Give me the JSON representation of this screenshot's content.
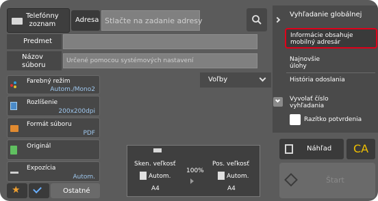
{
  "header": {
    "phonebook_label": "Telefónny\nzoznam",
    "address_tab": "Adresa",
    "address_placeholder": "Stlačte na zadanie adresy"
  },
  "fields": {
    "subject_label": "Predmet",
    "filename_label": "Názov\nsúboru",
    "filename_value": "Určené pomocou systémových nastavení"
  },
  "settings": {
    "color_mode": {
      "label": "Farebný režim",
      "value": "Autom./Mono2"
    },
    "resolution": {
      "label": "Rozlíšenie",
      "value": "200x200dpi"
    },
    "file_format": {
      "label": "Formát súboru",
      "value": "PDF"
    },
    "original": {
      "label": "Originál",
      "value": ""
    },
    "exposure": {
      "label": "Expozícia",
      "value": "Autom."
    },
    "other_label": "Ostatné"
  },
  "options_label": "Voľby",
  "scan_summary": {
    "scan_size_label": "Sken. veľkosť",
    "scan_size_value": "Autom.",
    "scan_paper": "A4",
    "ratio": "100%",
    "send_size_label": "Pos. veľkosť",
    "send_size_value": "Autom.",
    "send_paper": "A4"
  },
  "right_menu": {
    "items": [
      {
        "label": "Vyhľadanie globálnej"
      },
      {
        "label": "Informácie obsahuje\nmobilný adresár"
      },
      {
        "label": "Najnovšie\núlohy"
      },
      {
        "label": "História odoslania"
      },
      {
        "label": "Vyvolať číslo\nvyhľadania"
      },
      {
        "label": "Razítko potvrdenia"
      }
    ]
  },
  "actions": {
    "preview_label": "Náhľad",
    "ca_label": "CA",
    "start_label": "Štart"
  },
  "colors": {
    "background": "#5b5b5b",
    "highlight_border": "#e0001a",
    "value_text": "#9ec7ee",
    "ca_color": "#f0c000"
  }
}
